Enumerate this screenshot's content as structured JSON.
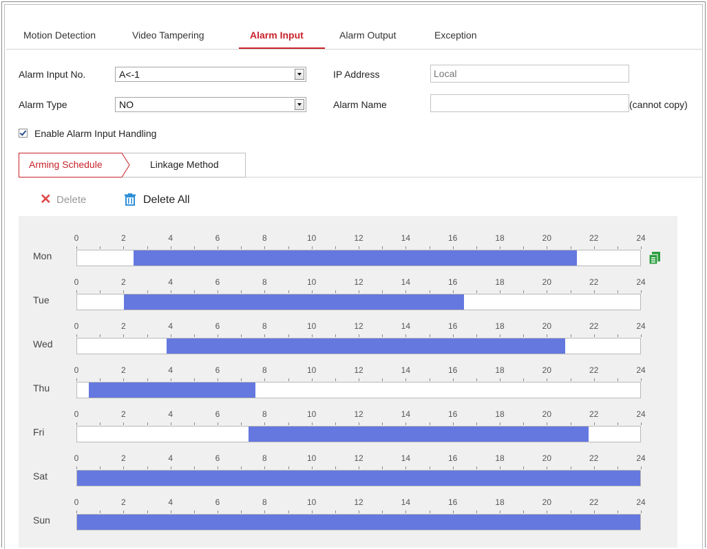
{
  "top_tabs": [
    {
      "label": "Motion Detection",
      "active": false
    },
    {
      "label": "Video Tampering",
      "active": false
    },
    {
      "label": "Alarm Input",
      "active": true
    },
    {
      "label": "Alarm Output",
      "active": false
    },
    {
      "label": "Exception",
      "active": false
    }
  ],
  "form": {
    "alarm_input_no_label": "Alarm Input No.",
    "alarm_input_no_value": "A<-1",
    "alarm_type_label": "Alarm Type",
    "alarm_type_value": "NO",
    "ip_address_label": "IP Address",
    "ip_address_placeholder": "Local",
    "alarm_name_label": "Alarm Name",
    "alarm_name_value": "",
    "cannot_copy_note": "(cannot copy)",
    "enable_handling_label": "Enable Alarm Input Handling",
    "enable_handling_checked": true
  },
  "sub_tabs": [
    {
      "label": "Arming Schedule",
      "active": true
    },
    {
      "label": "Linkage Method",
      "active": false
    }
  ],
  "toolbar": {
    "delete_label": "Delete",
    "delete_enabled": false,
    "delete_all_label": "Delete All"
  },
  "schedule": {
    "hour_labels": [
      "0",
      "2",
      "4",
      "6",
      "8",
      "10",
      "12",
      "14",
      "16",
      "18",
      "20",
      "22",
      "24"
    ],
    "days": [
      {
        "name": "Mon",
        "segments": [
          [
            2.4,
            21.3
          ]
        ]
      },
      {
        "name": "Tue",
        "segments": [
          [
            2.0,
            16.5
          ]
        ]
      },
      {
        "name": "Wed",
        "segments": [
          [
            3.8,
            20.8
          ]
        ]
      },
      {
        "name": "Thu",
        "segments": [
          [
            0.5,
            7.6
          ]
        ]
      },
      {
        "name": "Fri",
        "segments": [
          [
            7.3,
            21.8
          ]
        ]
      },
      {
        "name": "Sat",
        "segments": [
          [
            0,
            24
          ]
        ]
      },
      {
        "name": "Sun",
        "segments": [
          [
            0,
            24
          ]
        ]
      }
    ]
  },
  "colors": {
    "accent": "#c8222a",
    "schedule_bar": "#6478e0",
    "panel_bg": "#f0f0f0"
  },
  "icons": {
    "delete": "close-icon",
    "delete_all": "trash-icon",
    "copy": "copy-icon"
  }
}
